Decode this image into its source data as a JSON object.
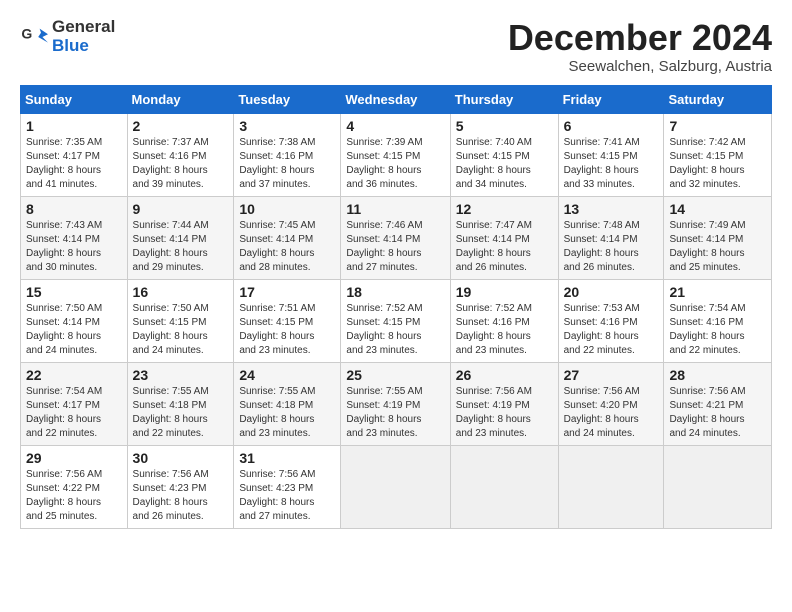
{
  "header": {
    "logo_line1": "General",
    "logo_line2": "Blue",
    "month": "December 2024",
    "location": "Seewalchen, Salzburg, Austria"
  },
  "weekdays": [
    "Sunday",
    "Monday",
    "Tuesday",
    "Wednesday",
    "Thursday",
    "Friday",
    "Saturday"
  ],
  "weeks": [
    [
      {
        "day": "1",
        "detail": "Sunrise: 7:35 AM\nSunset: 4:17 PM\nDaylight: 8 hours\nand 41 minutes."
      },
      {
        "day": "2",
        "detail": "Sunrise: 7:37 AM\nSunset: 4:16 PM\nDaylight: 8 hours\nand 39 minutes."
      },
      {
        "day": "3",
        "detail": "Sunrise: 7:38 AM\nSunset: 4:16 PM\nDaylight: 8 hours\nand 37 minutes."
      },
      {
        "day": "4",
        "detail": "Sunrise: 7:39 AM\nSunset: 4:15 PM\nDaylight: 8 hours\nand 36 minutes."
      },
      {
        "day": "5",
        "detail": "Sunrise: 7:40 AM\nSunset: 4:15 PM\nDaylight: 8 hours\nand 34 minutes."
      },
      {
        "day": "6",
        "detail": "Sunrise: 7:41 AM\nSunset: 4:15 PM\nDaylight: 8 hours\nand 33 minutes."
      },
      {
        "day": "7",
        "detail": "Sunrise: 7:42 AM\nSunset: 4:15 PM\nDaylight: 8 hours\nand 32 minutes."
      }
    ],
    [
      {
        "day": "8",
        "detail": "Sunrise: 7:43 AM\nSunset: 4:14 PM\nDaylight: 8 hours\nand 30 minutes."
      },
      {
        "day": "9",
        "detail": "Sunrise: 7:44 AM\nSunset: 4:14 PM\nDaylight: 8 hours\nand 29 minutes."
      },
      {
        "day": "10",
        "detail": "Sunrise: 7:45 AM\nSunset: 4:14 PM\nDaylight: 8 hours\nand 28 minutes."
      },
      {
        "day": "11",
        "detail": "Sunrise: 7:46 AM\nSunset: 4:14 PM\nDaylight: 8 hours\nand 27 minutes."
      },
      {
        "day": "12",
        "detail": "Sunrise: 7:47 AM\nSunset: 4:14 PM\nDaylight: 8 hours\nand 26 minutes."
      },
      {
        "day": "13",
        "detail": "Sunrise: 7:48 AM\nSunset: 4:14 PM\nDaylight: 8 hours\nand 26 minutes."
      },
      {
        "day": "14",
        "detail": "Sunrise: 7:49 AM\nSunset: 4:14 PM\nDaylight: 8 hours\nand 25 minutes."
      }
    ],
    [
      {
        "day": "15",
        "detail": "Sunrise: 7:50 AM\nSunset: 4:14 PM\nDaylight: 8 hours\nand 24 minutes."
      },
      {
        "day": "16",
        "detail": "Sunrise: 7:50 AM\nSunset: 4:15 PM\nDaylight: 8 hours\nand 24 minutes."
      },
      {
        "day": "17",
        "detail": "Sunrise: 7:51 AM\nSunset: 4:15 PM\nDaylight: 8 hours\nand 23 minutes."
      },
      {
        "day": "18",
        "detail": "Sunrise: 7:52 AM\nSunset: 4:15 PM\nDaylight: 8 hours\nand 23 minutes."
      },
      {
        "day": "19",
        "detail": "Sunrise: 7:52 AM\nSunset: 4:16 PM\nDaylight: 8 hours\nand 23 minutes."
      },
      {
        "day": "20",
        "detail": "Sunrise: 7:53 AM\nSunset: 4:16 PM\nDaylight: 8 hours\nand 22 minutes."
      },
      {
        "day": "21",
        "detail": "Sunrise: 7:54 AM\nSunset: 4:16 PM\nDaylight: 8 hours\nand 22 minutes."
      }
    ],
    [
      {
        "day": "22",
        "detail": "Sunrise: 7:54 AM\nSunset: 4:17 PM\nDaylight: 8 hours\nand 22 minutes."
      },
      {
        "day": "23",
        "detail": "Sunrise: 7:55 AM\nSunset: 4:18 PM\nDaylight: 8 hours\nand 22 minutes."
      },
      {
        "day": "24",
        "detail": "Sunrise: 7:55 AM\nSunset: 4:18 PM\nDaylight: 8 hours\nand 23 minutes."
      },
      {
        "day": "25",
        "detail": "Sunrise: 7:55 AM\nSunset: 4:19 PM\nDaylight: 8 hours\nand 23 minutes."
      },
      {
        "day": "26",
        "detail": "Sunrise: 7:56 AM\nSunset: 4:19 PM\nDaylight: 8 hours\nand 23 minutes."
      },
      {
        "day": "27",
        "detail": "Sunrise: 7:56 AM\nSunset: 4:20 PM\nDaylight: 8 hours\nand 24 minutes."
      },
      {
        "day": "28",
        "detail": "Sunrise: 7:56 AM\nSunset: 4:21 PM\nDaylight: 8 hours\nand 24 minutes."
      }
    ],
    [
      {
        "day": "29",
        "detail": "Sunrise: 7:56 AM\nSunset: 4:22 PM\nDaylight: 8 hours\nand 25 minutes."
      },
      {
        "day": "30",
        "detail": "Sunrise: 7:56 AM\nSunset: 4:23 PM\nDaylight: 8 hours\nand 26 minutes."
      },
      {
        "day": "31",
        "detail": "Sunrise: 7:56 AM\nSunset: 4:23 PM\nDaylight: 8 hours\nand 27 minutes."
      },
      null,
      null,
      null,
      null
    ]
  ]
}
